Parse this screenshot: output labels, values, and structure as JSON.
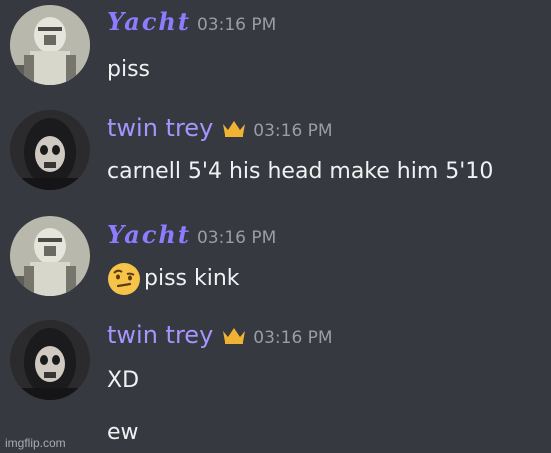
{
  "messages": [
    {
      "author": "Yacht",
      "timestamp": "03:16 PM",
      "lines": [
        "piss"
      ]
    },
    {
      "author": "twin trey",
      "timestamp": "03:16 PM",
      "lines": [
        "carnell 5'4 his head make him 5'10"
      ]
    },
    {
      "author": "Yacht",
      "timestamp": "03:16 PM",
      "emoji": "face-with-raised-eyebrow",
      "lines": [
        "piss kink"
      ]
    },
    {
      "author": "twin trey",
      "timestamp": "03:16 PM",
      "lines": [
        "XD",
        "ew"
      ]
    }
  ],
  "badges": {
    "owner_icon": "crown-icon",
    "crown_color": "#f0b232"
  },
  "colors": {
    "background": "#36393f",
    "yacht_name": "#8e7cff",
    "trey_name": "#a794ff",
    "timestamp": "#9a9da3",
    "message_text": "#f0f1f2"
  },
  "watermark": "imgflip.com"
}
